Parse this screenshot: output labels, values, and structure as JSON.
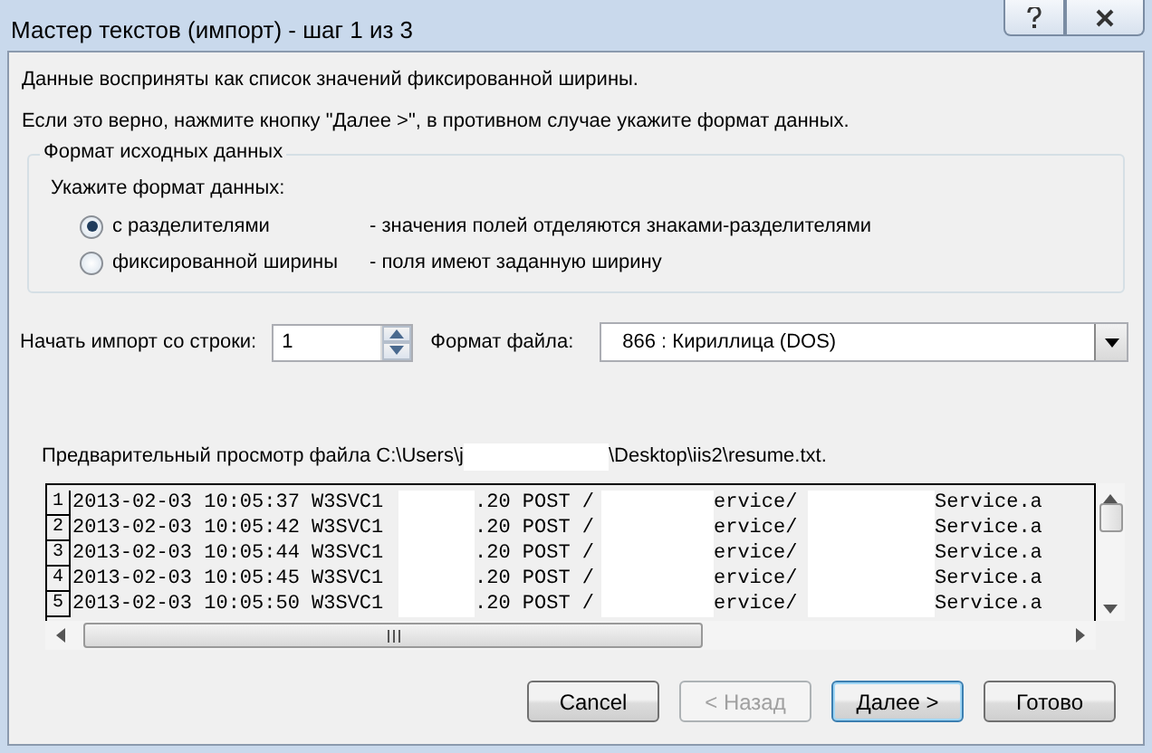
{
  "window": {
    "title": "Мастер текстов (импорт) - шаг 1 из 3"
  },
  "intro": [
    "Данные восприняты как список значений фиксированной ширины.",
    "Если это верно, нажмите кнопку \"Далее >\", в противном случае укажите формат данных."
  ],
  "group": {
    "title": "Формат исходных данных",
    "prompt": "Укажите формат данных:",
    "options": [
      {
        "label": "с разделителями",
        "description": "- значения полей отделяются знаками-разделителями",
        "selected": true
      },
      {
        "label": "фиксированной ширины",
        "description": "- поля имеют заданную ширину",
        "selected": false
      }
    ]
  },
  "start_row": {
    "label": "Начать импорт со строки:",
    "value": "1"
  },
  "file_format": {
    "label": "Формат файла:",
    "value": "866 : Кириллица (DOS)"
  },
  "preview": {
    "label_start": "Предварительный просмотр файла C:\\Users\\j",
    "label_end": "\\Desktop\\iis2\\resume.txt.",
    "rows": [
      {
        "number": "1",
        "segments": [
          "2013-02-03 10:05:37 W3SVC1",
          ".20 POST /",
          "ervice/",
          "Service.a"
        ]
      },
      {
        "number": "2",
        "segments": [
          "2013-02-03 10:05:42 W3SVC1",
          ".20 POST /",
          "ervice/",
          "Service.a"
        ]
      },
      {
        "number": "3",
        "segments": [
          "2013-02-03 10:05:44 W3SVC1",
          ".20 POST /",
          "ervice/",
          "Service.a"
        ]
      },
      {
        "number": "4",
        "segments": [
          "2013-02-03 10:05:45 W3SVC1",
          ".20 POST /",
          "ervice/",
          "Service.a"
        ]
      },
      {
        "number": "5",
        "segments": [
          "2013-02-03 10:05:50 W3SVC1",
          ".20 POST /",
          "ervice/",
          "Service.a"
        ]
      }
    ]
  },
  "buttons": [
    {
      "label": "Cancel",
      "disabled": false,
      "default": false
    },
    {
      "label": "< Назад",
      "disabled": true,
      "default": false
    },
    {
      "label": "Далее >",
      "disabled": false,
      "default": true
    },
    {
      "label": "Готово",
      "disabled": false,
      "default": false
    }
  ]
}
